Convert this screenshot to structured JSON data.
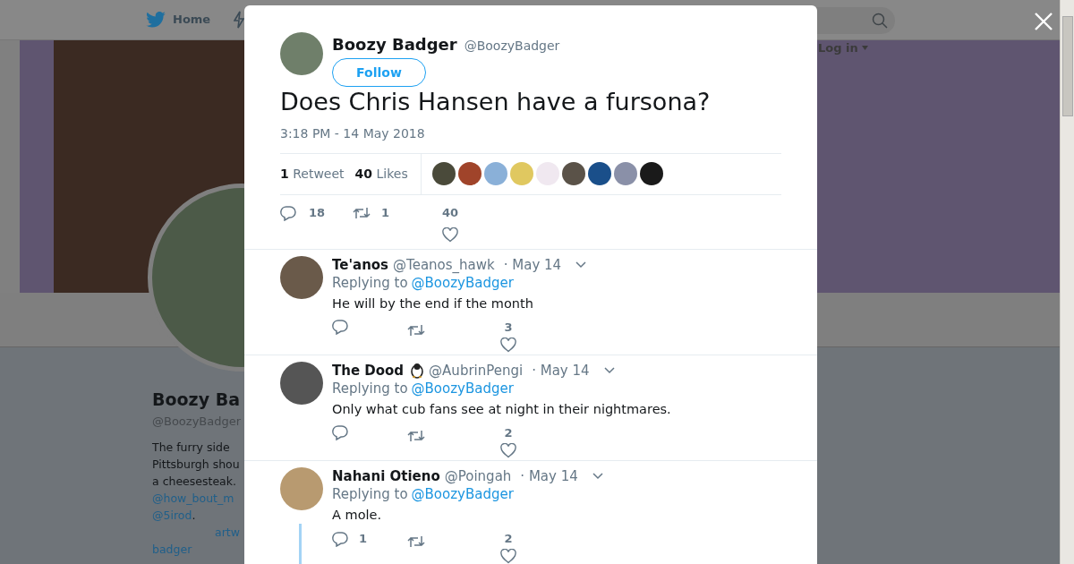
{
  "background_page": {
    "nav": {
      "home": "Home",
      "login": "Log in"
    },
    "profile": {
      "name": "Boozy Ba",
      "handle": "@BoozyBadger",
      "bio": [
        [
          {
            "kind": "text",
            "text": "The furry side"
          }
        ],
        [
          {
            "kind": "text",
            "text": "Pittsburgh shou"
          }
        ],
        [
          {
            "kind": "text",
            "text": "a cheesesteak."
          }
        ],
        [
          {
            "kind": "link",
            "text": "@how_bout_m"
          }
        ],
        [
          {
            "kind": "link",
            "text": "@5irod"
          },
          {
            "kind": "text",
            "text": "."
          }
        ],
        [
          {
            "kind": "indent-link",
            "text": "artw"
          }
        ],
        [
          {
            "kind": "link",
            "text": "badger"
          }
        ]
      ]
    }
  },
  "dialog": {
    "tweet": {
      "name": "Boozy Badger",
      "handle": "@BoozyBadger",
      "follow": "Follow",
      "text": "Does Chris Hansen have a fursona?",
      "time": "3:18 PM - 14 May 2018",
      "stats": [
        {
          "text": "**1** Retweet"
        },
        {
          "text": "**40** Likes"
        }
      ],
      "likers": [
        {
          "color": "#4a4a3a"
        },
        {
          "color": "#a0442a"
        },
        {
          "color": "#8ab0d8"
        },
        {
          "color": "#e0c860"
        },
        {
          "color": "#f0e8f0"
        },
        {
          "color": "#5a5248"
        },
        {
          "color": "#1a4f8a"
        },
        {
          "color": "#8a90a8"
        },
        {
          "color": "#1a1a1a"
        }
      ],
      "actions": {
        "replies": "18",
        "retweets": "1",
        "likes": "40"
      }
    },
    "replies": [
      {
        "name": "Te'anos",
        "name_icon": false,
        "handle": "@Teanos_hawk",
        "date": "· May 14",
        "replying_label": "Replying to",
        "replying_to": "@BoozyBadger",
        "text": "He will by the end if the month",
        "likes": "3",
        "thread_line": false
      },
      {
        "name": "The Dood",
        "name_icon": true,
        "handle": "@AubrinPengi",
        "date": "· May 14",
        "replying_label": "Replying to",
        "replying_to": "@BoozyBadger",
        "text": "Only what cub fans see at night in their nightmares.",
        "likes": "2",
        "thread_line": false
      },
      {
        "name": "Nahani Otieno",
        "name_icon": false,
        "handle": "@Poingah",
        "date": "· May 14",
        "replying_label": "Replying to",
        "replying_to": "@BoozyBadger",
        "text": "A mole.",
        "reply_count": "1",
        "likes": "2",
        "thread_line": true
      }
    ]
  }
}
